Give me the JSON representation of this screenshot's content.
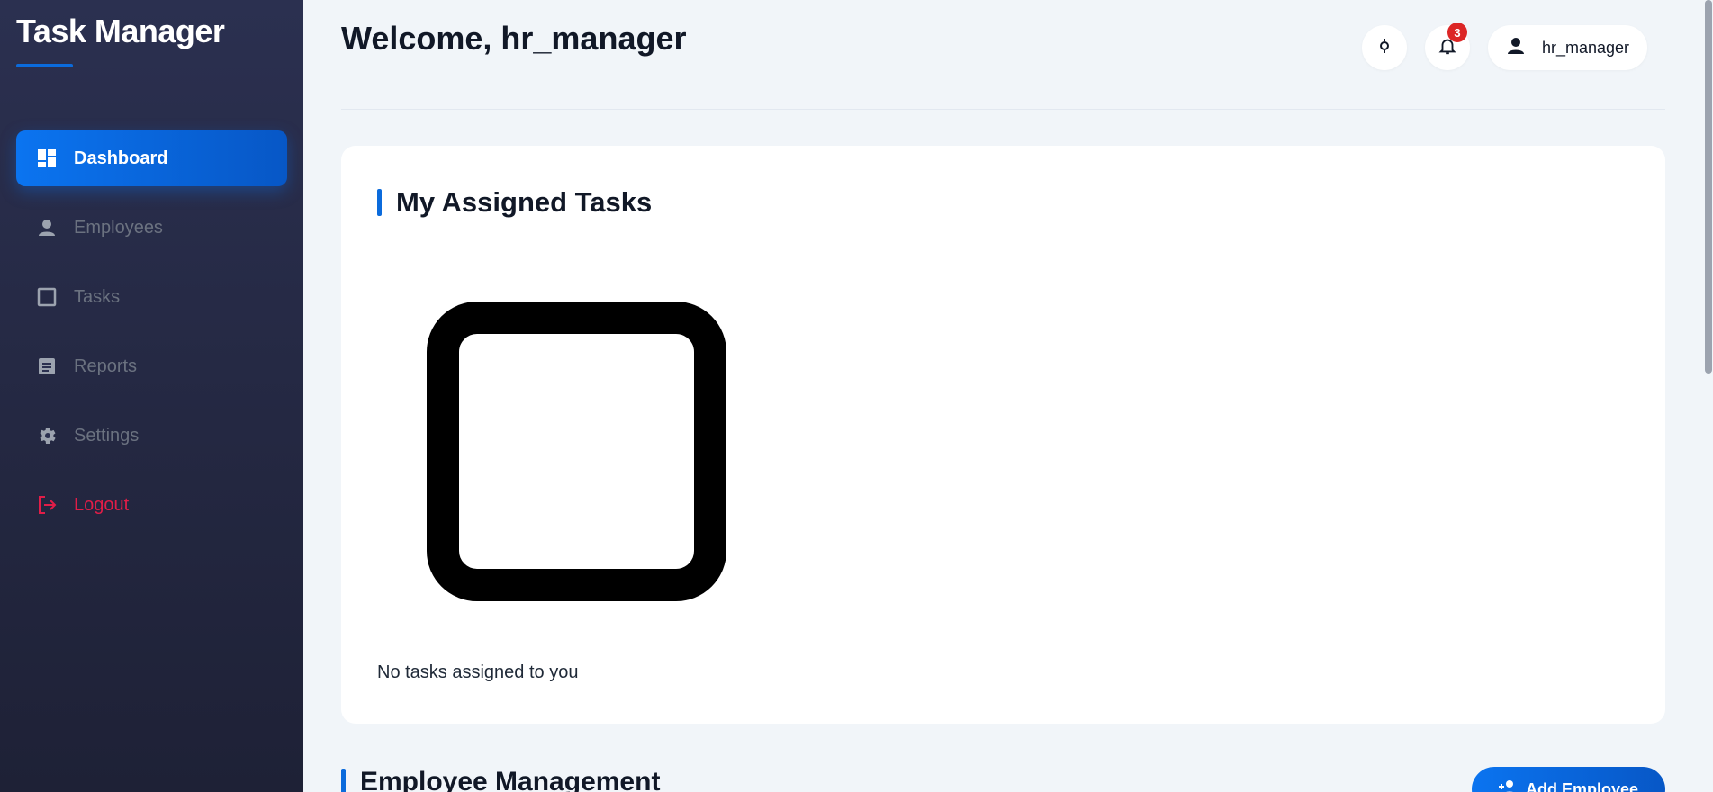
{
  "app": {
    "title": "Task Manager"
  },
  "sidebar": {
    "items": [
      {
        "label": "Dashboard",
        "icon": "dashboard-icon",
        "active": true
      },
      {
        "label": "Employees",
        "icon": "person-icon"
      },
      {
        "label": "Tasks",
        "icon": "checkbox-icon"
      },
      {
        "label": "Reports",
        "icon": "report-icon"
      },
      {
        "label": "Settings",
        "icon": "gear-icon"
      },
      {
        "label": "Logout",
        "icon": "logout-icon"
      }
    ]
  },
  "header": {
    "welcome": "Welcome, hr_manager",
    "notifications_count": "3",
    "username": "hr_manager"
  },
  "tasks_card": {
    "title": "My Assigned Tasks",
    "empty_message": "No tasks assigned to you"
  },
  "employee_section": {
    "title": "Employee Management",
    "add_label": "Add Employee"
  },
  "colors": {
    "accent": "#0b6bdc",
    "sidebar_bg": "#2b3050",
    "logout": "#e11d48",
    "badge": "#dc2626"
  }
}
